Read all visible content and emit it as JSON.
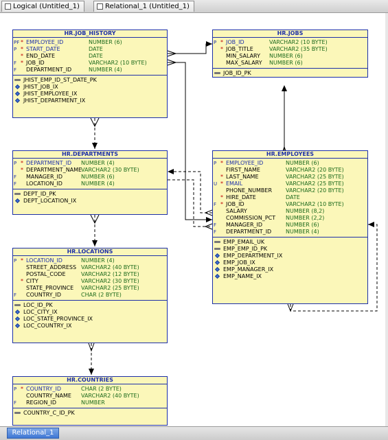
{
  "tabs": [
    "Logical (Untitled_1)",
    "Relational_1 (Untitled_1)"
  ],
  "bottom_tab": "Relational_1",
  "tables": {
    "job_history": {
      "title": "HR.JOB_HISTORY",
      "columns": [
        {
          "flag": "PF",
          "req": "*",
          "name": "EMPLOYEE_ID",
          "type": "NUMBER (6)",
          "pk": true
        },
        {
          "flag": "P",
          "req": "*",
          "name": "START_DATE",
          "type": "DATE",
          "pk": true
        },
        {
          "flag": "",
          "req": "*",
          "name": "END_DATE",
          "type": "DATE",
          "pk": false
        },
        {
          "flag": "F",
          "req": "*",
          "name": "JOB_ID",
          "type": "VARCHAR2 (10 BYTE)",
          "pk": false
        },
        {
          "flag": "F",
          "req": "",
          "name": "DEPARTMENT_ID",
          "type": "NUMBER (4)",
          "pk": false
        }
      ],
      "indexes": [
        {
          "kind": "key",
          "name": "JHIST_EMP_ID_ST_DATE_PK"
        },
        {
          "kind": "idx",
          "name": "JHIST_JOB_IX"
        },
        {
          "kind": "idx",
          "name": "JHIST_EMPLOYEE_IX"
        },
        {
          "kind": "idx",
          "name": "JHIST_DEPARTMENT_IX"
        }
      ]
    },
    "jobs": {
      "title": "HR.JOBS",
      "columns": [
        {
          "flag": "P",
          "req": "*",
          "name": "JOB_ID",
          "type": "VARCHAR2 (10 BYTE)",
          "pk": true
        },
        {
          "flag": "",
          "req": "*",
          "name": "JOB_TITLE",
          "type": "VARCHAR2 (35 BYTE)",
          "pk": false
        },
        {
          "flag": "",
          "req": "",
          "name": "MIN_SALARY",
          "type": "NUMBER (6)",
          "pk": false
        },
        {
          "flag": "",
          "req": "",
          "name": "MAX_SALARY",
          "type": "NUMBER (6)",
          "pk": false
        }
      ],
      "indexes": [
        {
          "kind": "key",
          "name": "JOB_ID_PK"
        }
      ]
    },
    "departments": {
      "title": "HR.DEPARTMENTS",
      "columns": [
        {
          "flag": "P",
          "req": "*",
          "name": "DEPARTMENT_ID",
          "type": "NUMBER (4)",
          "pk": true
        },
        {
          "flag": "",
          "req": "*",
          "name": "DEPARTMENT_NAME",
          "type": "VARCHAR2 (30 BYTE)",
          "pk": false
        },
        {
          "flag": "F",
          "req": "",
          "name": "MANAGER_ID",
          "type": "NUMBER (6)",
          "pk": false
        },
        {
          "flag": "F",
          "req": "",
          "name": "LOCATION_ID",
          "type": "NUMBER (4)",
          "pk": false
        }
      ],
      "indexes": [
        {
          "kind": "key",
          "name": "DEPT_ID_PK"
        },
        {
          "kind": "idx",
          "name": "DEPT_LOCATION_IX"
        }
      ]
    },
    "employees": {
      "title": "HR.EMPLOYEES",
      "columns": [
        {
          "flag": "P",
          "req": "*",
          "name": "EMPLOYEE_ID",
          "type": "NUMBER (6)",
          "pk": true
        },
        {
          "flag": "",
          "req": "",
          "name": "FIRST_NAME",
          "type": "VARCHAR2 (20 BYTE)",
          "pk": false
        },
        {
          "flag": "",
          "req": "*",
          "name": "LAST_NAME",
          "type": "VARCHAR2 (25 BYTE)",
          "pk": false
        },
        {
          "flag": "U",
          "req": "*",
          "name": "EMAIL",
          "type": "VARCHAR2 (25 BYTE)",
          "pk": true
        },
        {
          "flag": "",
          "req": "",
          "name": "PHONE_NUMBER",
          "type": "VARCHAR2 (20 BYTE)",
          "pk": false
        },
        {
          "flag": "",
          "req": "*",
          "name": "HIRE_DATE",
          "type": "DATE",
          "pk": false
        },
        {
          "flag": "F",
          "req": "*",
          "name": "JOB_ID",
          "type": "VARCHAR2 (10 BYTE)",
          "pk": false
        },
        {
          "flag": "",
          "req": "",
          "name": "SALARY",
          "type": "NUMBER (8,2)",
          "pk": false
        },
        {
          "flag": "",
          "req": "",
          "name": "COMMISSION_PCT",
          "type": "NUMBER (2,2)",
          "pk": false
        },
        {
          "flag": "F",
          "req": "",
          "name": "MANAGER_ID",
          "type": "NUMBER (6)",
          "pk": false
        },
        {
          "flag": "F",
          "req": "",
          "name": "DEPARTMENT_ID",
          "type": "NUMBER (4)",
          "pk": false
        }
      ],
      "indexes": [
        {
          "kind": "key",
          "name": "EMP_EMAIL_UK"
        },
        {
          "kind": "key",
          "name": "EMP_EMP_ID_PK"
        },
        {
          "kind": "idx",
          "name": "EMP_DEPARTMENT_IX"
        },
        {
          "kind": "idx",
          "name": "EMP_JOB_IX"
        },
        {
          "kind": "idx",
          "name": "EMP_MANAGER_IX"
        },
        {
          "kind": "idx",
          "name": "EMP_NAME_IX"
        }
      ]
    },
    "locations": {
      "title": "HR.LOCATIONS",
      "columns": [
        {
          "flag": "P",
          "req": "*",
          "name": "LOCATION_ID",
          "type": "NUMBER (4)",
          "pk": true
        },
        {
          "flag": "",
          "req": "",
          "name": "STREET_ADDRESS",
          "type": "VARCHAR2 (40 BYTE)",
          "pk": false
        },
        {
          "flag": "",
          "req": "",
          "name": "POSTAL_CODE",
          "type": "VARCHAR2 (12 BYTE)",
          "pk": false
        },
        {
          "flag": "",
          "req": "*",
          "name": "CITY",
          "type": "VARCHAR2 (30 BYTE)",
          "pk": false
        },
        {
          "flag": "",
          "req": "",
          "name": "STATE_PROVINCE",
          "type": "VARCHAR2 (25 BYTE)",
          "pk": false
        },
        {
          "flag": "F",
          "req": "",
          "name": "COUNTRY_ID",
          "type": "CHAR (2 BYTE)",
          "pk": false
        }
      ],
      "indexes": [
        {
          "kind": "key",
          "name": "LOC_ID_PK"
        },
        {
          "kind": "idx",
          "name": "LOC_CITY_IX"
        },
        {
          "kind": "idx",
          "name": "LOC_STATE_PROVINCE_IX"
        },
        {
          "kind": "idx",
          "name": "LOC_COUNTRY_IX"
        }
      ]
    },
    "countries": {
      "title": "HR.COUNTRIES",
      "columns": [
        {
          "flag": "P",
          "req": "*",
          "name": "COUNTRY_ID",
          "type": "CHAR (2 BYTE)",
          "pk": true
        },
        {
          "flag": "",
          "req": "",
          "name": "COUNTRY_NAME",
          "type": "VARCHAR2 (40 BYTE)",
          "pk": false
        },
        {
          "flag": "F",
          "req": "",
          "name": "REGION_ID",
          "type": "NUMBER",
          "pk": false
        }
      ],
      "indexes": [
        {
          "kind": "key",
          "name": "COUNTRY_C_ID_PK"
        }
      ]
    }
  },
  "colors": {
    "table_fill": "#fbf7b9",
    "table_border": "#1c2fa8",
    "type_text": "#1c6a1c",
    "required_star": "#c00000"
  }
}
